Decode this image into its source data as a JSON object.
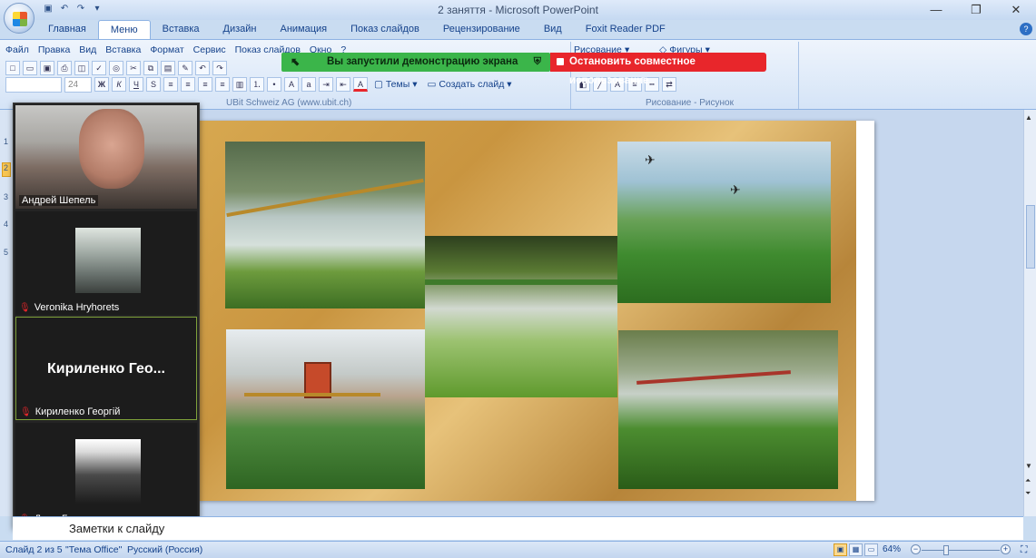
{
  "window": {
    "title": "2 заняття - Microsoft PowerPoint",
    "controls": {
      "minimize": "—",
      "restore": "❐",
      "close": "✕"
    }
  },
  "ribbon": {
    "tabs": [
      {
        "label": "Главная",
        "active": false
      },
      {
        "label": "Меню",
        "active": true
      },
      {
        "label": "Вставка",
        "active": false
      },
      {
        "label": "Дизайн",
        "active": false
      },
      {
        "label": "Анимация",
        "active": false
      },
      {
        "label": "Показ слайдов",
        "active": false
      },
      {
        "label": "Рецензирование",
        "active": false
      },
      {
        "label": "Вид",
        "active": false
      },
      {
        "label": "Foxit Reader PDF",
        "active": false
      }
    ],
    "menu_items": [
      "Файл",
      "Правка",
      "Вид",
      "Вставка",
      "Формат",
      "Сервис",
      "Показ слайдов",
      "Окно",
      "?"
    ],
    "font_size_placeholder": "24",
    "themes_label": "Темы",
    "create_slide_label": "Создать слайд",
    "group_left_label": "UBit Schweiz AG    (www.ubit.ch)",
    "drawing_label": "Рисование",
    "shapes_label": "Фигуры",
    "group_right_label": "Рисование - Рисунок"
  },
  "screen_share": {
    "status_text": "Вы запустили демонстрацию экрана",
    "stop_label": "Остановить совместное использование",
    "status_color": "#3bb54a",
    "stop_color": "#e8262b"
  },
  "thumbnails": [
    "1",
    "2",
    "3",
    "4",
    "5"
  ],
  "current_slide_index": 2,
  "participants": [
    {
      "name": "Андрей Шепель",
      "type": "video"
    },
    {
      "name": "Veronika Hryhorets",
      "type": "image",
      "muted": true
    },
    {
      "name": "Кириленко Георгій",
      "display": "Кириленко  Гео...",
      "type": "text",
      "muted": true,
      "active_speaker": true
    },
    {
      "name": "Дима Буш",
      "type": "image",
      "muted": true
    }
  ],
  "slide": {
    "photos": [
      {
        "subject": "tractor boom sprayer over crop rows"
      },
      {
        "subject": "agricultural drones spraying green field"
      },
      {
        "subject": "sprayer nozzles close-up"
      },
      {
        "subject": "red tractor spraying field"
      },
      {
        "subject": "field sprayer boom over soybean plants"
      }
    ]
  },
  "notes": {
    "placeholder": "Заметки к слайду"
  },
  "statusbar": {
    "slide_info": "Слайд 2 из 5",
    "theme": "\"Тема Office\"",
    "language": "Русский (Россия)",
    "zoom": "64%"
  }
}
